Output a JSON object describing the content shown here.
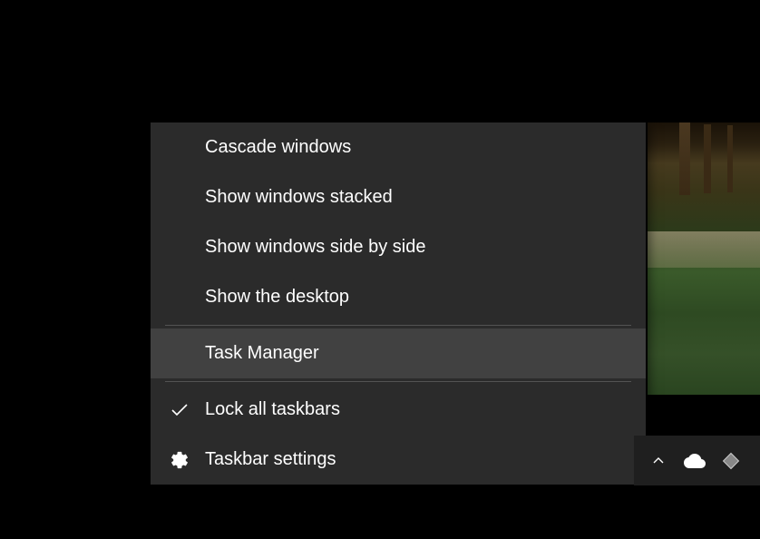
{
  "menu": {
    "items": [
      {
        "label": "Cascade windows",
        "icon": null,
        "highlighted": false
      },
      {
        "label": "Show windows stacked",
        "icon": null,
        "highlighted": false
      },
      {
        "label": "Show windows side by side",
        "icon": null,
        "highlighted": false
      },
      {
        "label": "Show the desktop",
        "icon": null,
        "highlighted": false
      },
      {
        "label": "Task Manager",
        "icon": null,
        "highlighted": true
      },
      {
        "label": "Lock all taskbars",
        "icon": "check",
        "highlighted": false
      },
      {
        "label": "Taskbar settings",
        "icon": "gear",
        "highlighted": false
      }
    ]
  },
  "tray": {
    "icons": [
      "chevron-up",
      "cloud",
      "diamond"
    ]
  }
}
